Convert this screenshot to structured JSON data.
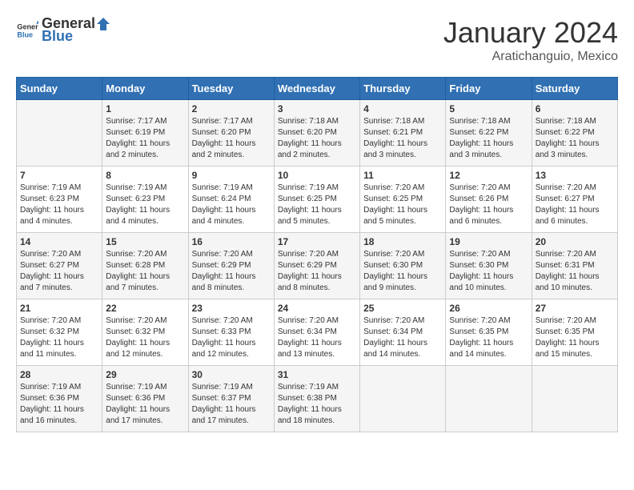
{
  "header": {
    "logo": {
      "general": "General",
      "blue": "Blue"
    },
    "month": "January 2024",
    "location": "Aratichanguio, Mexico"
  },
  "weekdays": [
    "Sunday",
    "Monday",
    "Tuesday",
    "Wednesday",
    "Thursday",
    "Friday",
    "Saturday"
  ],
  "weeks": [
    [
      {
        "day": "",
        "sunrise": "",
        "sunset": "",
        "daylight": ""
      },
      {
        "day": "1",
        "sunrise": "Sunrise: 7:17 AM",
        "sunset": "Sunset: 6:19 PM",
        "daylight": "Daylight: 11 hours and 2 minutes."
      },
      {
        "day": "2",
        "sunrise": "Sunrise: 7:17 AM",
        "sunset": "Sunset: 6:20 PM",
        "daylight": "Daylight: 11 hours and 2 minutes."
      },
      {
        "day": "3",
        "sunrise": "Sunrise: 7:18 AM",
        "sunset": "Sunset: 6:20 PM",
        "daylight": "Daylight: 11 hours and 2 minutes."
      },
      {
        "day": "4",
        "sunrise": "Sunrise: 7:18 AM",
        "sunset": "Sunset: 6:21 PM",
        "daylight": "Daylight: 11 hours and 3 minutes."
      },
      {
        "day": "5",
        "sunrise": "Sunrise: 7:18 AM",
        "sunset": "Sunset: 6:22 PM",
        "daylight": "Daylight: 11 hours and 3 minutes."
      },
      {
        "day": "6",
        "sunrise": "Sunrise: 7:18 AM",
        "sunset": "Sunset: 6:22 PM",
        "daylight": "Daylight: 11 hours and 3 minutes."
      }
    ],
    [
      {
        "day": "7",
        "sunrise": "Sunrise: 7:19 AM",
        "sunset": "Sunset: 6:23 PM",
        "daylight": "Daylight: 11 hours and 4 minutes."
      },
      {
        "day": "8",
        "sunrise": "Sunrise: 7:19 AM",
        "sunset": "Sunset: 6:23 PM",
        "daylight": "Daylight: 11 hours and 4 minutes."
      },
      {
        "day": "9",
        "sunrise": "Sunrise: 7:19 AM",
        "sunset": "Sunset: 6:24 PM",
        "daylight": "Daylight: 11 hours and 4 minutes."
      },
      {
        "day": "10",
        "sunrise": "Sunrise: 7:19 AM",
        "sunset": "Sunset: 6:25 PM",
        "daylight": "Daylight: 11 hours and 5 minutes."
      },
      {
        "day": "11",
        "sunrise": "Sunrise: 7:20 AM",
        "sunset": "Sunset: 6:25 PM",
        "daylight": "Daylight: 11 hours and 5 minutes."
      },
      {
        "day": "12",
        "sunrise": "Sunrise: 7:20 AM",
        "sunset": "Sunset: 6:26 PM",
        "daylight": "Daylight: 11 hours and 6 minutes."
      },
      {
        "day": "13",
        "sunrise": "Sunrise: 7:20 AM",
        "sunset": "Sunset: 6:27 PM",
        "daylight": "Daylight: 11 hours and 6 minutes."
      }
    ],
    [
      {
        "day": "14",
        "sunrise": "Sunrise: 7:20 AM",
        "sunset": "Sunset: 6:27 PM",
        "daylight": "Daylight: 11 hours and 7 minutes."
      },
      {
        "day": "15",
        "sunrise": "Sunrise: 7:20 AM",
        "sunset": "Sunset: 6:28 PM",
        "daylight": "Daylight: 11 hours and 7 minutes."
      },
      {
        "day": "16",
        "sunrise": "Sunrise: 7:20 AM",
        "sunset": "Sunset: 6:29 PM",
        "daylight": "Daylight: 11 hours and 8 minutes."
      },
      {
        "day": "17",
        "sunrise": "Sunrise: 7:20 AM",
        "sunset": "Sunset: 6:29 PM",
        "daylight": "Daylight: 11 hours and 8 minutes."
      },
      {
        "day": "18",
        "sunrise": "Sunrise: 7:20 AM",
        "sunset": "Sunset: 6:30 PM",
        "daylight": "Daylight: 11 hours and 9 minutes."
      },
      {
        "day": "19",
        "sunrise": "Sunrise: 7:20 AM",
        "sunset": "Sunset: 6:30 PM",
        "daylight": "Daylight: 11 hours and 10 minutes."
      },
      {
        "day": "20",
        "sunrise": "Sunrise: 7:20 AM",
        "sunset": "Sunset: 6:31 PM",
        "daylight": "Daylight: 11 hours and 10 minutes."
      }
    ],
    [
      {
        "day": "21",
        "sunrise": "Sunrise: 7:20 AM",
        "sunset": "Sunset: 6:32 PM",
        "daylight": "Daylight: 11 hours and 11 minutes."
      },
      {
        "day": "22",
        "sunrise": "Sunrise: 7:20 AM",
        "sunset": "Sunset: 6:32 PM",
        "daylight": "Daylight: 11 hours and 12 minutes."
      },
      {
        "day": "23",
        "sunrise": "Sunrise: 7:20 AM",
        "sunset": "Sunset: 6:33 PM",
        "daylight": "Daylight: 11 hours and 12 minutes."
      },
      {
        "day": "24",
        "sunrise": "Sunrise: 7:20 AM",
        "sunset": "Sunset: 6:34 PM",
        "daylight": "Daylight: 11 hours and 13 minutes."
      },
      {
        "day": "25",
        "sunrise": "Sunrise: 7:20 AM",
        "sunset": "Sunset: 6:34 PM",
        "daylight": "Daylight: 11 hours and 14 minutes."
      },
      {
        "day": "26",
        "sunrise": "Sunrise: 7:20 AM",
        "sunset": "Sunset: 6:35 PM",
        "daylight": "Daylight: 11 hours and 14 minutes."
      },
      {
        "day": "27",
        "sunrise": "Sunrise: 7:20 AM",
        "sunset": "Sunset: 6:35 PM",
        "daylight": "Daylight: 11 hours and 15 minutes."
      }
    ],
    [
      {
        "day": "28",
        "sunrise": "Sunrise: 7:19 AM",
        "sunset": "Sunset: 6:36 PM",
        "daylight": "Daylight: 11 hours and 16 minutes."
      },
      {
        "day": "29",
        "sunrise": "Sunrise: 7:19 AM",
        "sunset": "Sunset: 6:36 PM",
        "daylight": "Daylight: 11 hours and 17 minutes."
      },
      {
        "day": "30",
        "sunrise": "Sunrise: 7:19 AM",
        "sunset": "Sunset: 6:37 PM",
        "daylight": "Daylight: 11 hours and 17 minutes."
      },
      {
        "day": "31",
        "sunrise": "Sunrise: 7:19 AM",
        "sunset": "Sunset: 6:38 PM",
        "daylight": "Daylight: 11 hours and 18 minutes."
      },
      {
        "day": "",
        "sunrise": "",
        "sunset": "",
        "daylight": ""
      },
      {
        "day": "",
        "sunrise": "",
        "sunset": "",
        "daylight": ""
      },
      {
        "day": "",
        "sunrise": "",
        "sunset": "",
        "daylight": ""
      }
    ]
  ]
}
